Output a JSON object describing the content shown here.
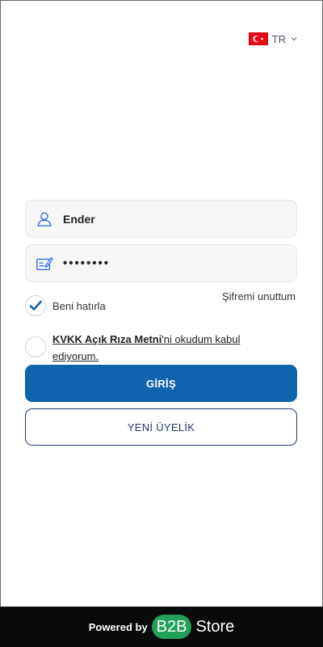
{
  "language": {
    "code": "TR",
    "flag_icon": "turkey-flag-icon",
    "chevron_icon": "chevron-down-icon"
  },
  "login_form": {
    "username": {
      "value": "Ender",
      "icon": "user-icon"
    },
    "password": {
      "value": "••••••••",
      "icon": "password-edit-icon"
    },
    "forgot_password": "Şifremi unuttum",
    "remember_me": {
      "label": "Beni hatırla",
      "checked": true
    },
    "kvkk": {
      "link_text": "KVKK Açık Rıza Metni",
      "suffix_text": "'ni okudum kabul ediyorum.",
      "checked": false
    },
    "login_button": "GİRİŞ",
    "register_button": "YENİ ÜYELİK"
  },
  "footer": {
    "powered_by": "Powered by",
    "brand_badge": "B2B",
    "brand_name": "Store"
  },
  "colors": {
    "primary": "#0f64ad",
    "outline": "#1d3a6e",
    "brand_green": "#22a05a",
    "footer_bg": "#0a0a0a",
    "flag_red": "#e30a17"
  }
}
